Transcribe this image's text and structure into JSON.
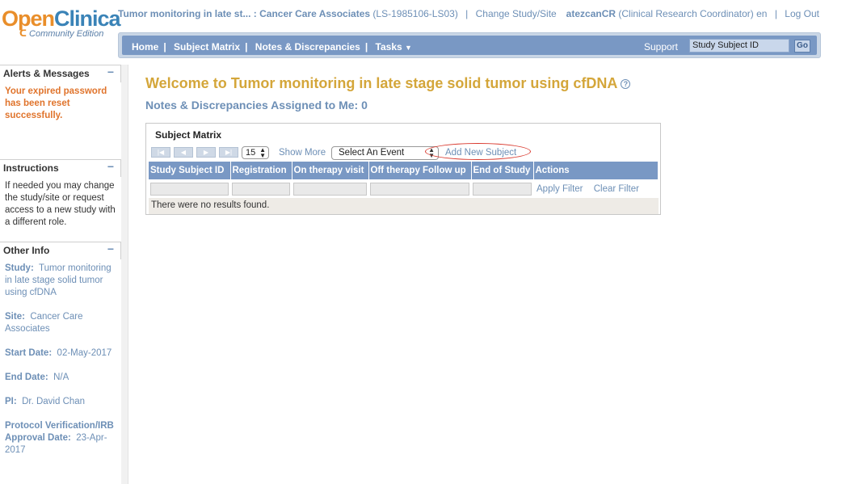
{
  "logo": {
    "brand_part1": "Open",
    "brand_part2": "Clinica",
    "edition": "Community Edition"
  },
  "header": {
    "study_short": "Tumor monitoring in late st... : Cancer Care Associates",
    "study_id": "(LS-1985106-LS03)",
    "change_study": "Change Study/Site",
    "username": "atezcanCR",
    "role": "(Clinical Research Coordinator)",
    "language": "en",
    "logout": "Log Out"
  },
  "nav": {
    "items": [
      "Home",
      "Subject Matrix",
      "Notes & Discrepancies",
      "Tasks"
    ],
    "support": "Support",
    "search_value": "Study Subject ID",
    "go": "Go"
  },
  "sidebar": {
    "alerts_title": "Alerts & Messages",
    "alerts_text": "Your expired password has been reset successfully.",
    "instructions_title": "Instructions",
    "instructions_text": "If needed you may change the study/site or request access to a new study with a different role.",
    "other_title": "Other Info",
    "study_label": "Study:",
    "study_value": "Tumor monitoring in late stage solid tumor using cfDNA",
    "site_label": "Site:",
    "site_value": "Cancer Care Associates",
    "start_label": "Start Date:",
    "start_value": "02-May-2017",
    "end_label": "End Date:",
    "end_value": "N/A",
    "pi_label": "PI:",
    "pi_value": "Dr. David Chan",
    "protocol_label": "Protocol Verification/IRB Approval Date:",
    "protocol_value": "23-Apr-2017",
    "collapse_symbol": "−"
  },
  "main": {
    "welcome": "Welcome to Tumor monitoring in late stage solid tumor using cfDNA",
    "notes_assigned": "Notes & Discrepancies Assigned to Me: 0",
    "matrix_title": "Subject Matrix",
    "page_size": "15",
    "show_more": "Show More",
    "event_select": "Select An Event",
    "add_subject": "Add New Subject",
    "columns": [
      "Study Subject ID",
      "Registration",
      "On therapy visit",
      "Off therapy Follow up",
      "End of Study",
      "Actions"
    ],
    "apply_filter": "Apply Filter",
    "clear_filter": "Clear Filter",
    "no_results": "There were no results found."
  },
  "colors": {
    "accent_blue": "#7998c4",
    "title_gold": "#d4a63a",
    "alert_orange": "#e0742c",
    "link_blue": "#6d8fb6"
  }
}
